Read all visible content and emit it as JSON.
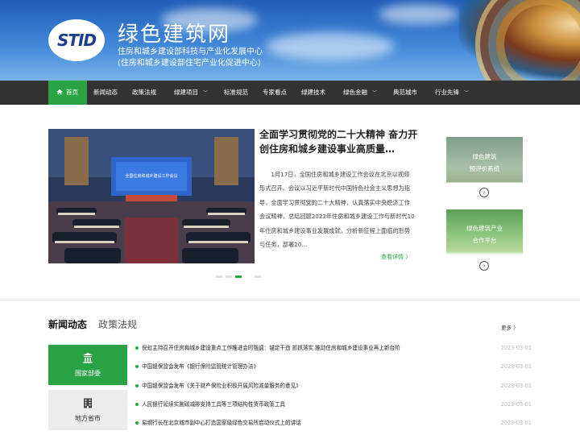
{
  "header": {
    "logo_text": "STID",
    "title": "绿色建筑网",
    "subtitle_1": "住房和城乡建设部科技与产业化发展中心",
    "subtitle_2": "(住房和城乡建设部住宅产业化促进中心)"
  },
  "nav": {
    "items": [
      {
        "label": "首页",
        "active": true
      },
      {
        "label": "新闻动态"
      },
      {
        "label": "政策法规"
      },
      {
        "label": "绿建项目",
        "dropdown": true
      },
      {
        "label": "标准规范"
      },
      {
        "label": "专家看点"
      },
      {
        "label": "绿建技术"
      },
      {
        "label": "绿色金融",
        "dropdown": true
      },
      {
        "label": "典范城市"
      },
      {
        "label": "行业先锋",
        "dropdown": true
      }
    ],
    "chevron": "﹀"
  },
  "featured": {
    "image_banner_text": "全国住房和城乡建设工作会议",
    "title": "全面学习贯彻党的二十大精神 奋力开创住房和城乡建设事业高质量…",
    "body": "1月17日，全国住房和城乡建设工作会议在北京以视频形式召开。会议以习近平新时代中国特色社会主义思想为指导，全面学习贯彻党的二十大精神，认真落实中央经济工作会议精神，总结回顾2022年住房和城乡建设工作与新时代10年住房和城乡建设事业发展成就，分析新征程上面临的形势与任务，部署20…",
    "more_label": "查看详情 〉",
    "slider_count": 4,
    "slider_active": 2
  },
  "side_cards": [
    {
      "line1": "绿色建筑",
      "line2": "预评价系统",
      "arrow": "›"
    },
    {
      "line1": "绿色建筑产业",
      "line2": "合作平台",
      "arrow": "›"
    }
  ],
  "news_section": {
    "tabs": [
      {
        "label": "新闻动态",
        "active": true
      },
      {
        "label": "政策法规",
        "active": false
      }
    ],
    "more_label": "更多 〉",
    "categories": [
      {
        "label": "国家部委",
        "icon": "bank-icon",
        "active": true
      },
      {
        "label": "地方省市",
        "icon": "building-icon",
        "active": false
      }
    ],
    "items": [
      {
        "title": "倪虹主持召开住房和城乡建设重点工作推进会时强调：锚定干劲 抓抓落实 推动住房和城乡建设事业再上新台阶",
        "date": "2023-03-01"
      },
      {
        "title": "中国银保监会发布《银行保险监管统计管理办法》",
        "date": "2023-03-01"
      },
      {
        "title": "中国银保监会发布《关于财产保险业积极开展风险减量服务的意见》",
        "date": "2023-03-01"
      },
      {
        "title": "人民银行延续实施碳减排支持工具等三项结构性货币政策工具",
        "date": "2023-03-01"
      },
      {
        "title": "易纲行长在北京城市副中心打造国家级绿色交易所启动仪式上的讲话",
        "date": "2023-03-01"
      }
    ]
  },
  "colors": {
    "accent": "#2aa344",
    "nav_bg": "#333333",
    "date": "#bbbbbb"
  }
}
